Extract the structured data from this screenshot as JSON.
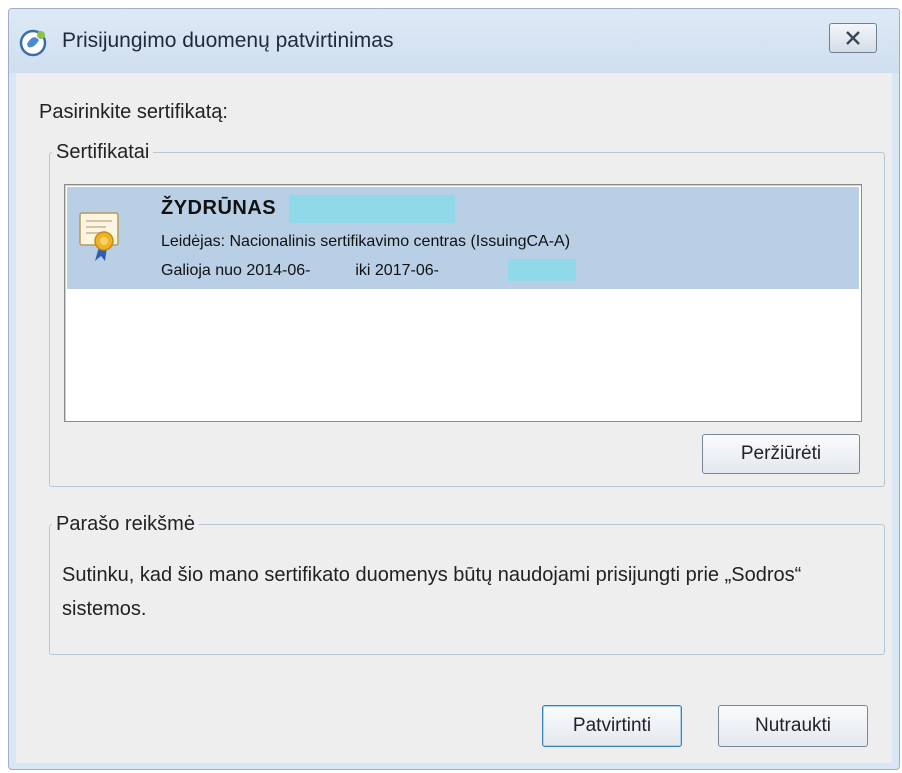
{
  "window": {
    "title": "Prisijungimo duomenų patvirtinimas",
    "icon": "app-logo-icon",
    "close_icon": "close-icon"
  },
  "prompt": "Pasirinkite sertifikatą:",
  "certificates": {
    "legend": "Sertifikatai",
    "items": [
      {
        "name": "ŽYDRŪNAS",
        "issuer": "Leidėjas: Nacionalinis sertifikavimo centras (IssuingCA-A)",
        "valid_from_label": "Galioja nuo 2014-06-",
        "valid_to_label": "iki 2017-06-",
        "icon": "certificate-icon",
        "selected": true
      }
    ],
    "view_button": "Peržiūrėti"
  },
  "signature": {
    "legend": "Parašo reikšmė",
    "text": "Sutinku, kad šio mano sertifikato duomenys būtų naudojami prisijungti prie „Sodros“ sistemos."
  },
  "buttons": {
    "confirm": "Patvirtinti",
    "cancel": "Nutraukti"
  },
  "colors": {
    "selection": "#b8cfe6",
    "redaction": "#8fd9e8",
    "frame": "#d8e6f5"
  }
}
